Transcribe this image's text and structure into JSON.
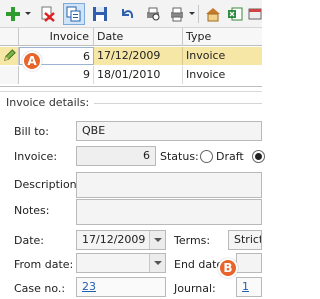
{
  "toolbar": {
    "buttons": [
      "new-icon",
      "delete-icon",
      "copy-icon",
      "save-icon",
      "undo-icon",
      "print-icon",
      "print-options-icon",
      "export-icon",
      "excel-icon",
      "tools-icon"
    ]
  },
  "grid": {
    "columns": [
      "",
      "Invoice",
      "Date",
      "Type"
    ],
    "rows": [
      {
        "invoice": "6",
        "date": "17/12/2009",
        "type": "Invoice"
      },
      {
        "invoice": "9",
        "date": "18/01/2010",
        "type": "Invoice"
      }
    ]
  },
  "details": {
    "title": "Invoice details:",
    "bill_to_label": "Bill to:",
    "bill_to_value": "QBE",
    "invoice_label": "Invoice:",
    "invoice_value": "6",
    "status_label": "Status:",
    "status_draft": "Draft",
    "description_label": "Description:",
    "notes_label": "Notes:",
    "date_label": "Date:",
    "date_value": "17/12/2009",
    "terms_label": "Terms:",
    "terms_value": "Strict",
    "from_date_label": "From date:",
    "end_date_label": "End date:",
    "case_no_label": "Case no.:",
    "case_no_value": "23",
    "journal_label": "Journal:",
    "journal_value": "1"
  },
  "callouts": {
    "a": "A",
    "b": "B"
  },
  "colors": {
    "selected_row": "#f6e7a6",
    "callout": "#e8642a",
    "link": "#1f5fb0"
  }
}
